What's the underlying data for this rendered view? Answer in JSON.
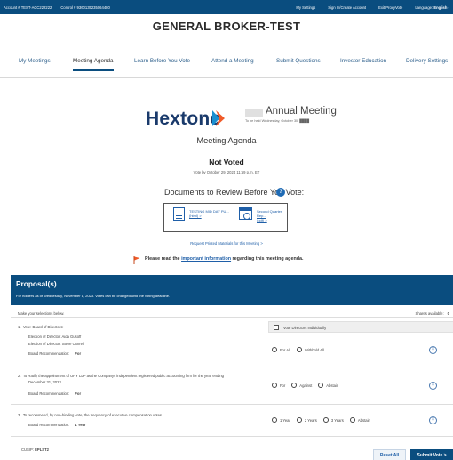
{
  "topbar": {
    "account": "Account # TEST-ACC222222",
    "control": "Control # 9360135235064480",
    "my_settings": "My Settings",
    "sign_in": "Sign In/Create Account",
    "exit": "Exit ProxyVote",
    "language_label": "Language:",
    "language_value": "English -"
  },
  "broker_name": "GENERAL BROKER-TEST",
  "nav": {
    "items": [
      {
        "label": "My Meetings"
      },
      {
        "label": "Meeting Agenda"
      },
      {
        "label": "Learn Before You Vote"
      },
      {
        "label": "Attend a Meeting"
      },
      {
        "label": "Submit Questions"
      },
      {
        "label": "Investor Education"
      },
      {
        "label": "Delivery Settings"
      }
    ],
    "active": "Meeting Agenda"
  },
  "company": {
    "logo_text": "Hextone",
    "meeting_title": "Annual Meeting",
    "meeting_subtitle": "To be held Wednesday, October 30, ████"
  },
  "agenda_title": "Meeting Agenda",
  "status": {
    "label": "Not Voted",
    "vote_by": "Vote by October 29, 2024 11:59 p.m. ET"
  },
  "documents": {
    "title": "Documents to Review Before You Vote:",
    "help_icon": "?",
    "items": [
      {
        "name": "TESTING MID DAY PU...",
        "format": "(html) >",
        "icon": "document-icon"
      },
      {
        "name": "Second Quarter Rep...",
        "format": "(pdf) >",
        "icon": "calendar-icon"
      }
    ]
  },
  "request_link": "Request Printed Materials for this Meeting  >",
  "notice": {
    "before": "Please read the ",
    "link": "important information",
    "after": " regarding this meeting agenda."
  },
  "proposals": {
    "title": "Proposal(s)",
    "subtitle": "For holders as of Wednesday, November 1, 2023. Votes can be changed until the voting deadline.",
    "instructions": "Make your selections below.",
    "shares_label": "Shares available:",
    "shares_value": "0",
    "items": [
      {
        "number": "1.",
        "text": "Vote: Board of Directors:",
        "directors": [
          "Election of Director: Aida Gusoff",
          "Election of Director: Steve Oxnrell"
        ],
        "rec_label": "Board Recommendation:",
        "rec_value": "For",
        "vdi_label": "Vote Directors Individually",
        "options": [
          "For All",
          "Withhold All"
        ]
      },
      {
        "number": "2.",
        "text": "To Ratify the appointment of UHY LLP as the Companys independent registered public accounting firm for the year ending",
        "text2": "December 31, 2023.",
        "rec_label": "Board Recommendation:",
        "rec_value": "For",
        "options": [
          "For",
          "Against",
          "Abstain"
        ]
      },
      {
        "number": "3.",
        "text": "To recommend, by non-binding vote, the frequency of executive compensation votes.",
        "rec_label": "Board Recommendation:",
        "rec_value": "1 Year",
        "options": [
          "1 Year",
          "2 Years",
          "3 Years",
          "Abstain"
        ]
      }
    ]
  },
  "footer": {
    "cusip_label": "CUSIP:",
    "cusip_value": "EPLST2",
    "reset_label": "Reset All",
    "submit_label": "Submit Vote  >"
  },
  "colors": {
    "brand_blue": "#0a4d7f",
    "link_blue": "#1f5fa8",
    "logo_orange": "#f05a28"
  }
}
